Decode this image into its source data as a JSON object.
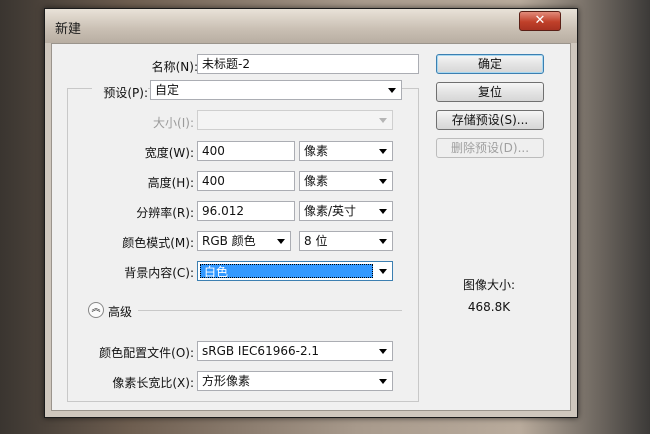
{
  "dialog": {
    "title": "新建",
    "close_glyph": "✕",
    "name_label": "名称(N):",
    "name_value": "未标题-2",
    "preset_label": "预设(P):",
    "preset_value": "自定",
    "size_label": "大小(I):",
    "size_value": "",
    "width_label": "宽度(W):",
    "width_value": "400",
    "width_unit": "像素",
    "height_label": "高度(H):",
    "height_value": "400",
    "height_unit": "像素",
    "resolution_label": "分辨率(R):",
    "resolution_value": "96.012",
    "resolution_unit": "像素/英寸",
    "color_mode_label": "颜色模式(M):",
    "color_mode_value": "RGB 颜色",
    "bit_depth_value": "8 位",
    "bg_label": "背景内容(C):",
    "bg_value": "白色",
    "advanced_label": "高级",
    "profile_label": "颜色配置文件(O):",
    "profile_value": "sRGB IEC61966-2.1",
    "aspect_label": "像素长宽比(X):",
    "aspect_value": "方形像素",
    "image_size_label": "图像大小:",
    "image_size_value": "468.8K"
  },
  "buttons": {
    "ok": "确定",
    "reset": "复位",
    "save_preset": "存储预设(S)...",
    "delete_preset": "删除预设(D)..."
  },
  "icons": {
    "dropdown": "chevron-down-icon",
    "advanced_toggle": "chevron-up-circle-icon",
    "advanced_glyph": "︽"
  }
}
